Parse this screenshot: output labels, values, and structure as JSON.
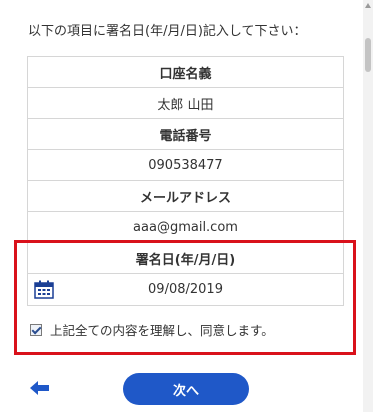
{
  "instruction": "以下の項目に署名日(年/月/日)記入して下さい：",
  "fields": [
    {
      "label": "口座名義",
      "value": "太郎 山田"
    },
    {
      "label": "電話番号",
      "value": "090538477"
    },
    {
      "label": "メールアドレス",
      "value": "aaa@gmail.com"
    }
  ],
  "signature": {
    "label": "署名日(年/月/日)",
    "date": "09/08/2019",
    "calendar_icon": "calendar-icon"
  },
  "consent": {
    "checked": true,
    "text": "上記全ての内容を理解し、同意します。"
  },
  "nav": {
    "back_icon": "arrow-left-icon",
    "next_label": "次へ"
  },
  "colors": {
    "highlight": "#d9111b",
    "primary_button": "#1f58c8"
  }
}
